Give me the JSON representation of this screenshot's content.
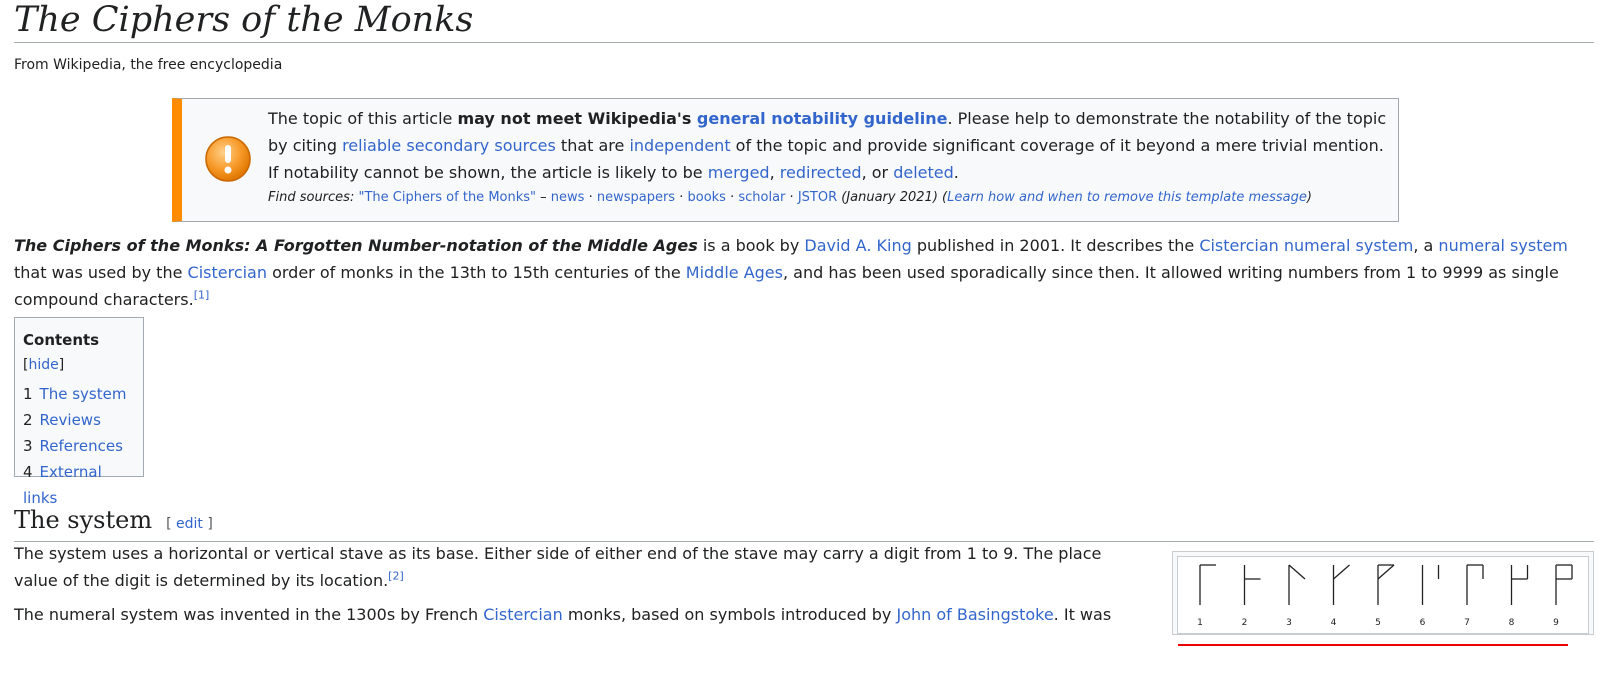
{
  "article": {
    "title": "The Ciphers of the Monks",
    "tagline": "From Wikipedia, the free encyclopedia"
  },
  "notice": {
    "t1": "The topic of this article ",
    "t2": "may not meet Wikipedia's ",
    "link1": "general notability guideline",
    "t3": ". Please help to demonstrate the notability of the topic by citing ",
    "link2": "reliable secondary sources",
    "t4": " that are ",
    "link3": "independent",
    "t5": " of the topic and provide significant coverage of it beyond a mere trivial mention. If notability cannot be shown, the article is likely to be ",
    "link4": "merged",
    "t6": ", ",
    "link5": "redirected",
    "t7": ", or ",
    "link6": "deleted",
    "t8": ".",
    "find_label": "Find sources:",
    "find_query": "\"The Ciphers of the Monks\"",
    "find_dash": " – ",
    "src_news": "news",
    "src_newspapers": "newspapers",
    "src_books": "books",
    "src_scholar": "scholar",
    "src_jstor": "JSTOR",
    "dot": " · ",
    "date": " (January 2021)",
    "learn": "Learn how and when to remove this template message"
  },
  "lead": {
    "bold": "The Ciphers of the Monks: A Forgotten Number-notation of the Middle Ages",
    "t1": " is a book by ",
    "l1": "David A. King",
    "t2": " published in 2001. It describes the ",
    "l2": "Cistercian numeral system",
    "t3": ", a ",
    "l3": "numeral system",
    "t4": " that was used by the ",
    "l4": "Cistercian",
    "t5": " order of monks in the 13th to 15th centuries of the ",
    "l5": "Middle Ages",
    "t6": ", and has been used sporadically since then. It allowed writing numbers from 1 to 9999 as single compound characters.",
    "ref": "[1]"
  },
  "toc": {
    "title": "Contents",
    "hide": "hide",
    "items": [
      {
        "num": "1",
        "label": "The system"
      },
      {
        "num": "2",
        "label": "Reviews"
      },
      {
        "num": "3",
        "label": "References"
      },
      {
        "num": "4",
        "label": "External links"
      }
    ]
  },
  "section": {
    "title": "The system",
    "edit": "edit",
    "p1": "The system uses a horizontal or vertical stave as its base. Either side of either end of the stave may carry a digit from 1 to 9. The place value of the digit is determined by its location.",
    "p1_ref": "[2]",
    "p2_t1": "The numeral system was invented in the 1300s by French ",
    "p2_l1": "Cistercian",
    "p2_t2": " monks, based on symbols introduced by ",
    "p2_l2": "John of Basingstoke",
    "p2_t3": ". It was"
  },
  "figure": {
    "digits": [
      "1",
      "2",
      "3",
      "4",
      "5",
      "6",
      "7",
      "8",
      "9"
    ]
  }
}
